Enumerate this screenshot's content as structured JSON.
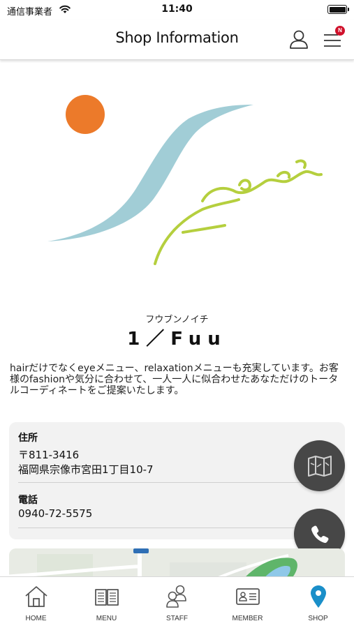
{
  "status_bar": {
    "carrier": "通信事業者",
    "time": "11:40"
  },
  "header": {
    "title": "Shop Information",
    "notification_badge": "N",
    "user_icon": "user-icon",
    "menu_icon": "hamburger-menu-icon"
  },
  "shop": {
    "name_kana": "フウブンノイチ",
    "name": "1／Fuu",
    "description": "hairだけでなくeyeメニュー、relaxationメニューも充実しています。お客様のfashionや気分に合わせて、一人一人に似合わせたあなただけのトータルコーディネートをご提案いたします。"
  },
  "info": {
    "address_label": "住所",
    "postal_code": "〒811-3416",
    "address": "福岡県宗像市宮田1丁目10-7",
    "phone_label": "電話",
    "phone": "0940-72-5575"
  },
  "floating_buttons": {
    "map": "map-icon",
    "call": "phone-icon"
  },
  "colors": {
    "accent": "#1a8fc9",
    "logo_orange": "#ec7a2a",
    "logo_blue": "#9ccad4",
    "logo_green": "#b5cf3e",
    "badge_red": "#d0122c",
    "fab_gray": "#474747"
  },
  "tabs": [
    {
      "label": "HOME",
      "icon": "home-icon",
      "active": false
    },
    {
      "label": "MENU",
      "icon": "book-icon",
      "active": false
    },
    {
      "label": "STAFF",
      "icon": "staff-icon",
      "active": false
    },
    {
      "label": "MEMBER",
      "icon": "member-card-icon",
      "active": false
    },
    {
      "label": "SHOP",
      "icon": "location-pin-icon",
      "active": true
    }
  ]
}
